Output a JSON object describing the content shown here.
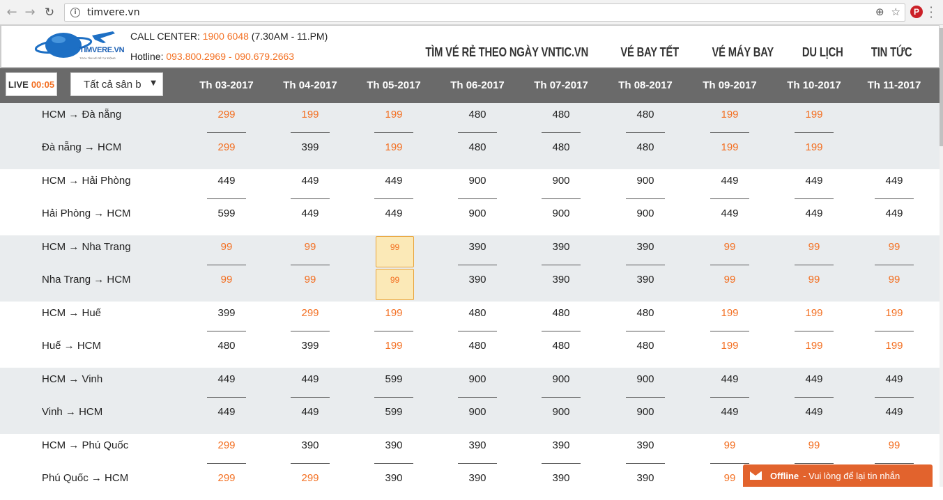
{
  "browser": {
    "url": "timvere.vn",
    "back_icon": "arrow-left-icon",
    "forward_icon": "arrow-right-icon",
    "reload_icon": "reload-icon"
  },
  "header": {
    "logo_text": "TIMVERE.VN",
    "logo_sub": "TOOL TÌM VÉ RẺ TỰ ĐỘNG",
    "call_label": "CALL CENTER: ",
    "call_number": "1900 6048",
    "call_hours": " (7.30AM - 11.PM)",
    "hotline_label": "Hotline: ",
    "hotline_numbers": "093.800.2969 - 090.679.2663",
    "nav": [
      "TÌM VÉ RẺ THEO NGÀY VNTIC.VN",
      "VÉ BAY TẾT",
      "VÉ MÁY BAY",
      "DU LỊCH",
      "TIN TỨC"
    ]
  },
  "toolbar": {
    "live_label": "LIVE",
    "live_time": "00:05",
    "airport_select": "Tất cả sân b"
  },
  "months": [
    "Th 03-2017",
    "Th 04-2017",
    "Th 05-2017",
    "Th 06-2017",
    "Th 07-2017",
    "Th 08-2017",
    "Th 09-2017",
    "Th 10-2017",
    "Th 11-2017"
  ],
  "routes": [
    {
      "name": "HCM → Đà nẵng",
      "prices": [
        "299",
        "199",
        "199",
        "480",
        "480",
        "480",
        "199",
        "199",
        ""
      ],
      "hot": [
        1,
        1,
        1,
        0,
        0,
        0,
        1,
        1,
        0
      ]
    },
    {
      "name": "Đà nẵng → HCM",
      "prices": [
        "299",
        "399",
        "199",
        "480",
        "480",
        "480",
        "199",
        "199",
        ""
      ],
      "hot": [
        1,
        0,
        1,
        0,
        0,
        0,
        1,
        1,
        0
      ]
    },
    {
      "name": "HCM → Hải Phòng",
      "prices": [
        "449",
        "449",
        "449",
        "900",
        "900",
        "900",
        "449",
        "449",
        "449"
      ],
      "hot": [
        0,
        0,
        0,
        0,
        0,
        0,
        0,
        0,
        0
      ]
    },
    {
      "name": "Hải Phòng → HCM",
      "prices": [
        "599",
        "449",
        "449",
        "900",
        "900",
        "900",
        "449",
        "449",
        "449"
      ],
      "hot": [
        0,
        0,
        0,
        0,
        0,
        0,
        0,
        0,
        0
      ]
    },
    {
      "name": "HCM → Nha Trang",
      "prices": [
        "99",
        "99",
        "99",
        "390",
        "390",
        "390",
        "99",
        "99",
        "99"
      ],
      "hot": [
        1,
        1,
        1,
        0,
        0,
        0,
        1,
        1,
        1
      ]
    },
    {
      "name": "Nha Trang → HCM",
      "prices": [
        "99",
        "99",
        "99",
        "390",
        "390",
        "390",
        "99",
        "99",
        "99"
      ],
      "hot": [
        1,
        1,
        1,
        0,
        0,
        0,
        1,
        1,
        1
      ]
    },
    {
      "name": "HCM → Huế",
      "prices": [
        "399",
        "299",
        "199",
        "480",
        "480",
        "480",
        "199",
        "199",
        "199"
      ],
      "hot": [
        0,
        1,
        1,
        0,
        0,
        0,
        1,
        1,
        1
      ]
    },
    {
      "name": "Huế → HCM",
      "prices": [
        "480",
        "399",
        "199",
        "480",
        "480",
        "480",
        "199",
        "199",
        "199"
      ],
      "hot": [
        0,
        0,
        1,
        0,
        0,
        0,
        1,
        1,
        1
      ]
    },
    {
      "name": "HCM → Vinh",
      "prices": [
        "449",
        "449",
        "599",
        "900",
        "900",
        "900",
        "449",
        "449",
        "449"
      ],
      "hot": [
        0,
        0,
        0,
        0,
        0,
        0,
        0,
        0,
        0
      ]
    },
    {
      "name": "Vinh → HCM",
      "prices": [
        "449",
        "449",
        "599",
        "900",
        "900",
        "900",
        "449",
        "449",
        "449"
      ],
      "hot": [
        0,
        0,
        0,
        0,
        0,
        0,
        0,
        0,
        0
      ]
    },
    {
      "name": "HCM → Phú Quốc",
      "prices": [
        "299",
        "390",
        "390",
        "390",
        "390",
        "390",
        "99",
        "99",
        "99"
      ],
      "hot": [
        1,
        0,
        0,
        0,
        0,
        0,
        1,
        1,
        1
      ]
    },
    {
      "name": "Phú Quốc → HCM",
      "prices": [
        "299",
        "299",
        "390",
        "390",
        "390",
        "390",
        "99",
        "",
        ""
      ],
      "hot": [
        1,
        1,
        0,
        0,
        0,
        0,
        1,
        0,
        0
      ]
    }
  ],
  "highlighted_cells": [
    {
      "route_index": 4,
      "month_index": 2
    },
    {
      "route_index": 5,
      "month_index": 2
    }
  ],
  "chat": {
    "status": "Offline",
    "message": "- Vui lòng để lại tin nhắn"
  },
  "colors": {
    "accent": "#f36f21",
    "bar": "#6a6a6a",
    "shade": "#e9ecee",
    "highlight": "#fbe9b7",
    "chat": "#e2632d"
  }
}
